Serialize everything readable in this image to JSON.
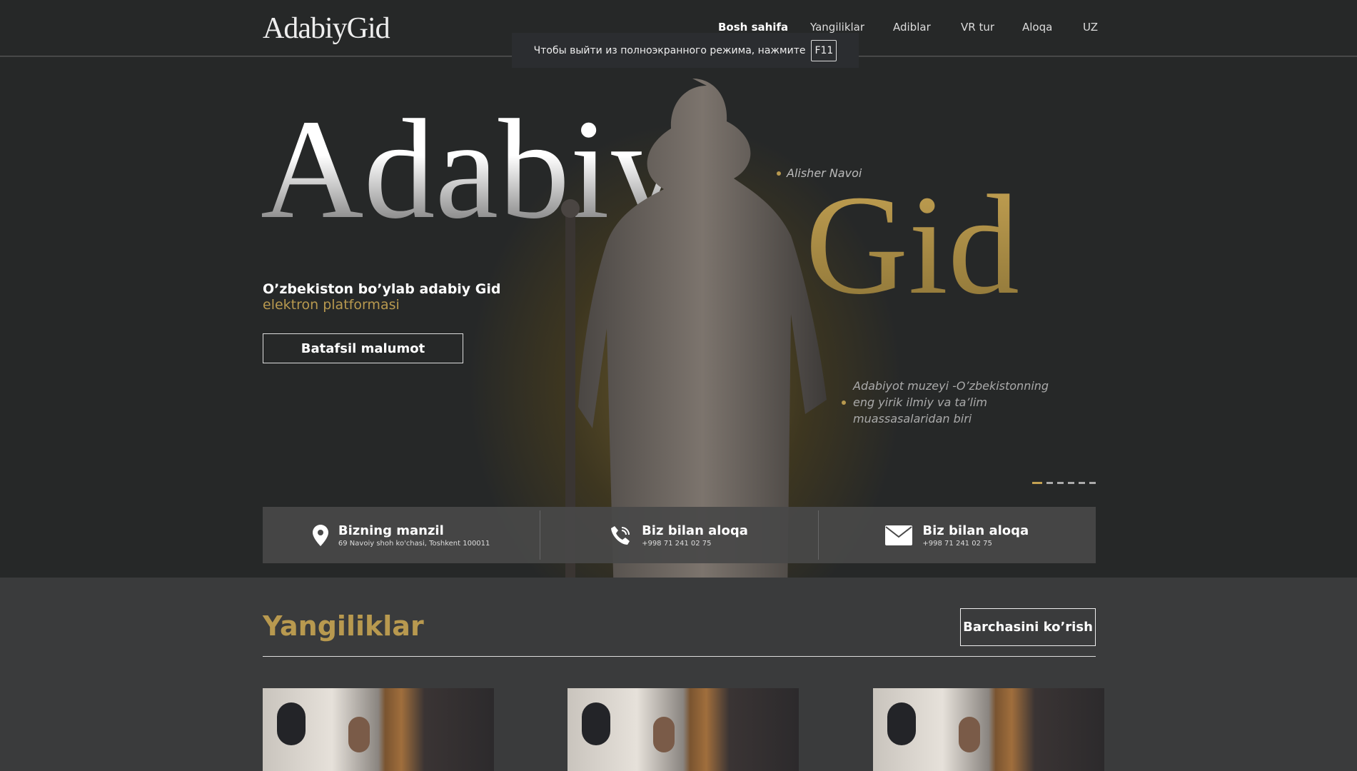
{
  "header": {
    "logo": "AdabiyGid",
    "nav": [
      "Bosh sahifa",
      "Yangiliklar",
      "Adiblar",
      "VR tur",
      "Aloqa",
      "UZ"
    ]
  },
  "toast": {
    "text": "Чтобы выйти из полноэкранного режима, нажмите",
    "key": "F11"
  },
  "hero": {
    "word1": "Adabiy",
    "word2": "Gid",
    "caption": "Alisher Navoi",
    "subtitle_line1": "O’zbekiston bo’ylab adabiy Gid",
    "subtitle_line2": "elektron platformasi",
    "button": "Batafsil malumot",
    "description": "Adabiyot muzeyi -O’zbekistonning eng yirik ilmiy va ta’lim muassasalaridan biri",
    "slides": 6,
    "active_slide": 1
  },
  "info": [
    {
      "icon": "map-pin-icon",
      "title": "Bizning manzil",
      "text": "69 Navoiy shoh ko'chasi, Toshkent 100011"
    },
    {
      "icon": "phone-icon",
      "title": "Biz bilan aloqa",
      "text": "+998 71 241 02 75"
    },
    {
      "icon": "mail-icon",
      "title": "Biz bilan aloqa",
      "text": "+998 71 241 02 75"
    }
  ],
  "news": {
    "title": "Yangiliklar",
    "all_button": "Barchasini ko’rish"
  },
  "colors": {
    "accent": "#b8994f",
    "bg": "#262828",
    "section": "#3a3b3c"
  }
}
